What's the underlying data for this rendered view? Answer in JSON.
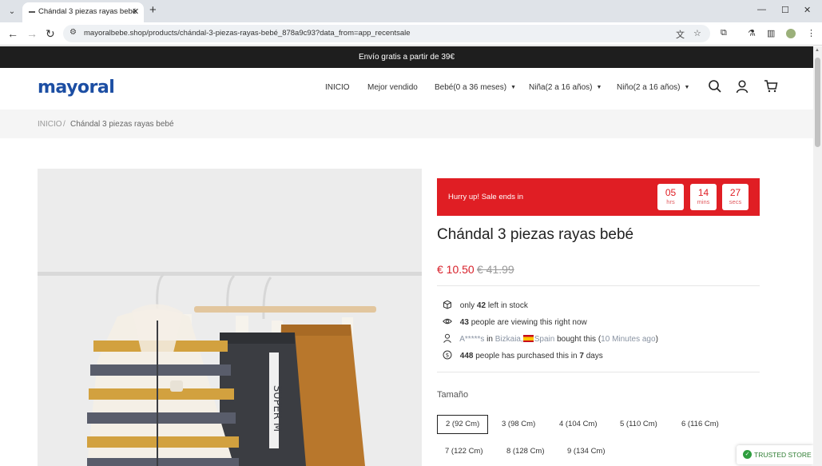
{
  "browser": {
    "tab_title": "Chándal 3 piezas rayas bebé",
    "url": "mayoralbebe.shop/products/chándal-3-piezas-rayas-bebé_878a9c93?data_from=app_recentsale"
  },
  "announcement": "Envío gratis a partir de 39€",
  "header": {
    "logo": "mayoral",
    "nav": [
      {
        "label": "INICIO"
      },
      {
        "label": "Mejor vendido"
      },
      {
        "label": "Bebé(0 a 36 meses)"
      },
      {
        "label": "Niña(2 a 16 años)"
      },
      {
        "label": "Niño(2 a 16 años)"
      }
    ]
  },
  "breadcrumb": {
    "home": "INICIO",
    "separator": "/",
    "current": "Chándal 3 piezas rayas bebé"
  },
  "countdown": {
    "text": "Hurry up!  Sale ends in",
    "hours": "05",
    "hours_unit": "hrs",
    "mins": "14",
    "mins_unit": "mins",
    "secs": "27",
    "secs_unit": "secs"
  },
  "product": {
    "title": "Chándal 3 piezas rayas bebé",
    "price": "€ 10.50",
    "compare_price": "€ 41.99"
  },
  "social_proof": {
    "stock": {
      "pre": "only",
      "count": "42",
      "post": "left in stock"
    },
    "viewing": {
      "count": "43",
      "post": "people are viewing this right now"
    },
    "recent": {
      "name": "A*****s",
      "in": "in",
      "region": "Bizkaia,",
      "country": "Spain",
      "action": "bought this",
      "time_open": "(",
      "time": "10 Minutes ago",
      "time_close": ")"
    },
    "purchased": {
      "count": "448",
      "mid": "people has purchased this in",
      "days": "7",
      "post": "days"
    }
  },
  "sizes": {
    "label": "Tamaño",
    "options": [
      "2 (92 Cm)",
      "3 (98 Cm)",
      "4 (104 Cm)",
      "5 (110 Cm)",
      "6 (116 Cm)",
      "7 (122 Cm)",
      "8 (128 Cm)",
      "9 (134 Cm)"
    ],
    "selected": "2 (92 Cm)"
  },
  "trusted_badge": "TRUSTED STORE",
  "colors": {
    "sale_red": "#e01e24",
    "brand_blue": "#1c4ea3",
    "announce_bg": "#1e1e1e"
  }
}
